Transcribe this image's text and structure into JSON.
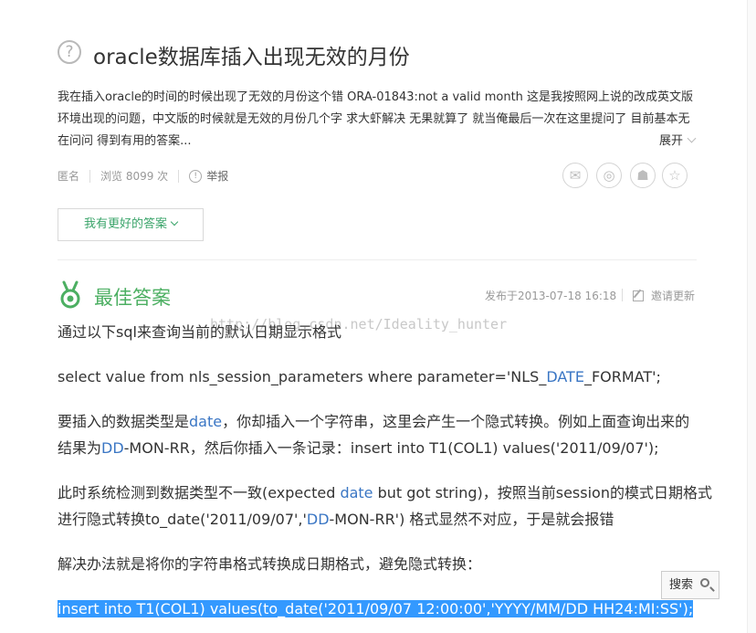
{
  "question": {
    "title": "oracle数据库插入出现无效的月份",
    "body": "我在插入oracle的时间的时候出现了无效的月份这个错 ORA-01843:not a valid month 这是我按照网上说的改成英文版环境出现的问题，中文版的时候就是无效的月份几个字 求大虾解决 无果就算了 就当俺最后一次在这里提问了 目前基本无在问问 得到有用的答案...",
    "expand_label": "展开",
    "author": "匿名",
    "views": "浏览 8099 次",
    "report_label": "举报",
    "share_icons": [
      "wechat-icon",
      "weibo-icon",
      "qq-icon",
      "star-icon"
    ]
  },
  "better_answer_button": "我有更好的答案",
  "best_answer": {
    "label": "最佳答案",
    "published": "发布于2013-07-18 16:18",
    "invite_label": "邀请更新",
    "watermark": "http://blog.csdn.net/Ideality_hunter",
    "paragraphs": [
      "通过以下sql来查询当前的默认日期显示格式",
      "select value from nls_session_parameters where parameter='NLS_DATE_FORMAT';",
      "要插入的数据类型是date，你却插入一个字符串，这里会产生一个隐式转换。例如上面查询出来的",
      "结果为DD-MON-RR，然后你插入一条记录：insert into T1(COL1) values('2011/09/07');",
      "此时系统检测到数据类型不一致(expected date but got string)，按照当前session的模式日期格式",
      "进行隐式转换to_date('2011/09/07','DD-MON-RR') 格式显然不对应，于是就会报错",
      "解决办法就是将你的字符串格式转换成日期格式，避免隐式转换：",
      "insert into T1(COL1) values(to_date('2011/09/07 12:00:00','YYYY/MM/DD HH24:MI:SS');"
    ]
  },
  "search_button": "搜索",
  "colors": {
    "accent_green": "#4caf62",
    "keyword_blue": "#3a76c4",
    "selection": "#3399ff"
  }
}
